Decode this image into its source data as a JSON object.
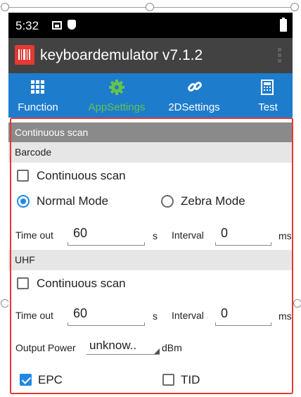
{
  "status": {
    "time": "5:32"
  },
  "app": {
    "title": "keyboardemulator v7.1.2"
  },
  "tabs": [
    {
      "label": "Function",
      "icon": "grid-icon",
      "active": false
    },
    {
      "label": "AppSettings",
      "icon": "gear-icon",
      "active": true
    },
    {
      "label": "2DSettings",
      "icon": "link-icon",
      "active": false
    },
    {
      "label": "Test",
      "icon": "calculator-icon",
      "active": false
    }
  ],
  "settings": {
    "section_header": "Continuous scan",
    "barcode": {
      "header": "Barcode",
      "continuous_label": "Continuous scan",
      "continuous_checked": false,
      "normal_mode_label": "Normal Mode",
      "normal_mode_selected": true,
      "zebra_mode_label": "Zebra Mode",
      "zebra_mode_selected": false,
      "timeout_label": "Time out",
      "timeout_value": "60",
      "timeout_unit": "s",
      "interval_label": "Interval",
      "interval_value": "0",
      "interval_unit": "ms"
    },
    "uhf": {
      "header": "UHF",
      "continuous_label": "Continuous scan",
      "continuous_checked": false,
      "timeout_label": "Time out",
      "timeout_value": "60",
      "timeout_unit": "s",
      "interval_label": "Interval",
      "interval_value": "0",
      "interval_unit": "ms",
      "output_power_label": "Output Power",
      "output_power_value": "unknow..",
      "output_power_unit": "dBm",
      "epc_label": "EPC",
      "epc_checked": true,
      "tid_label": "TID",
      "tid_checked": false
    }
  },
  "colors": {
    "tabbar": "#1e7ccd",
    "active_tab": "#66c24d",
    "titlebar": "#424242",
    "highlight_border": "#e53935",
    "accent": "#1e88e5"
  }
}
